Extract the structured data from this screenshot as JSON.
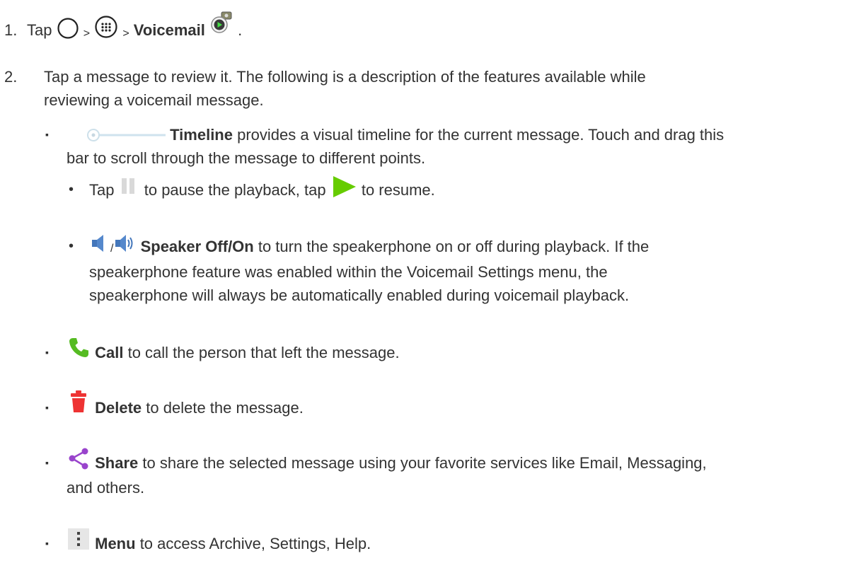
{
  "step1": {
    "number": "1.",
    "tap": "Tap",
    "sep1": ">",
    "sep2": ">",
    "voicemail": "Voicemail",
    "end": "."
  },
  "step2": {
    "number": "2.",
    "line1": "Tap a message to review it. The following is a description of the features available while",
    "line2": "reviewing a voicemail message."
  },
  "timeline": {
    "label": "Timeline",
    "text1": " provides a visual timeline for the current message. Touch and drag this",
    "text2": "bar to scroll through the message to different points."
  },
  "pause": {
    "prefix": "Tap",
    "middle": "to pause the playback, tap",
    "suffix": "to resume."
  },
  "speaker": {
    "slash": "/",
    "label": "Speaker Off/On",
    "text1": " to turn the speakerphone on or off during playback. If the",
    "text2": "speakerphone feature was enabled within the Voicemail Settings menu, the",
    "text3": "speakerphone will always be automatically enabled during voicemail playback."
  },
  "call": {
    "label": "Call",
    "text": " to call the person that left the message."
  },
  "delete": {
    "label": "Delete",
    "text": " to delete the message."
  },
  "share": {
    "label": "Share",
    "text1": " to share the selected message using your favorite services like Email, Messaging,",
    "text2": "and others."
  },
  "menu": {
    "label": "Menu",
    "text": " to access Archive, Settings, Help."
  },
  "markers": {
    "square": "▪",
    "dot": "•"
  },
  "icons": {
    "home": "home-circle-icon",
    "apps": "apps-grid-icon",
    "voicemail": "voicemail-app-icon",
    "timeline": "timeline-slider-icon",
    "pause": "pause-icon",
    "play": "play-icon",
    "speaker_off": "speaker-off-icon",
    "speaker_on": "speaker-on-icon",
    "call": "phone-icon",
    "delete": "trash-icon",
    "share": "share-icon",
    "menu": "overflow-menu-icon"
  },
  "colors": {
    "text": "#333333",
    "play": "#66cc00",
    "call": "#55bb22",
    "delete": "#ee3333",
    "share": "#9944cc",
    "speaker": "#4477bb"
  }
}
